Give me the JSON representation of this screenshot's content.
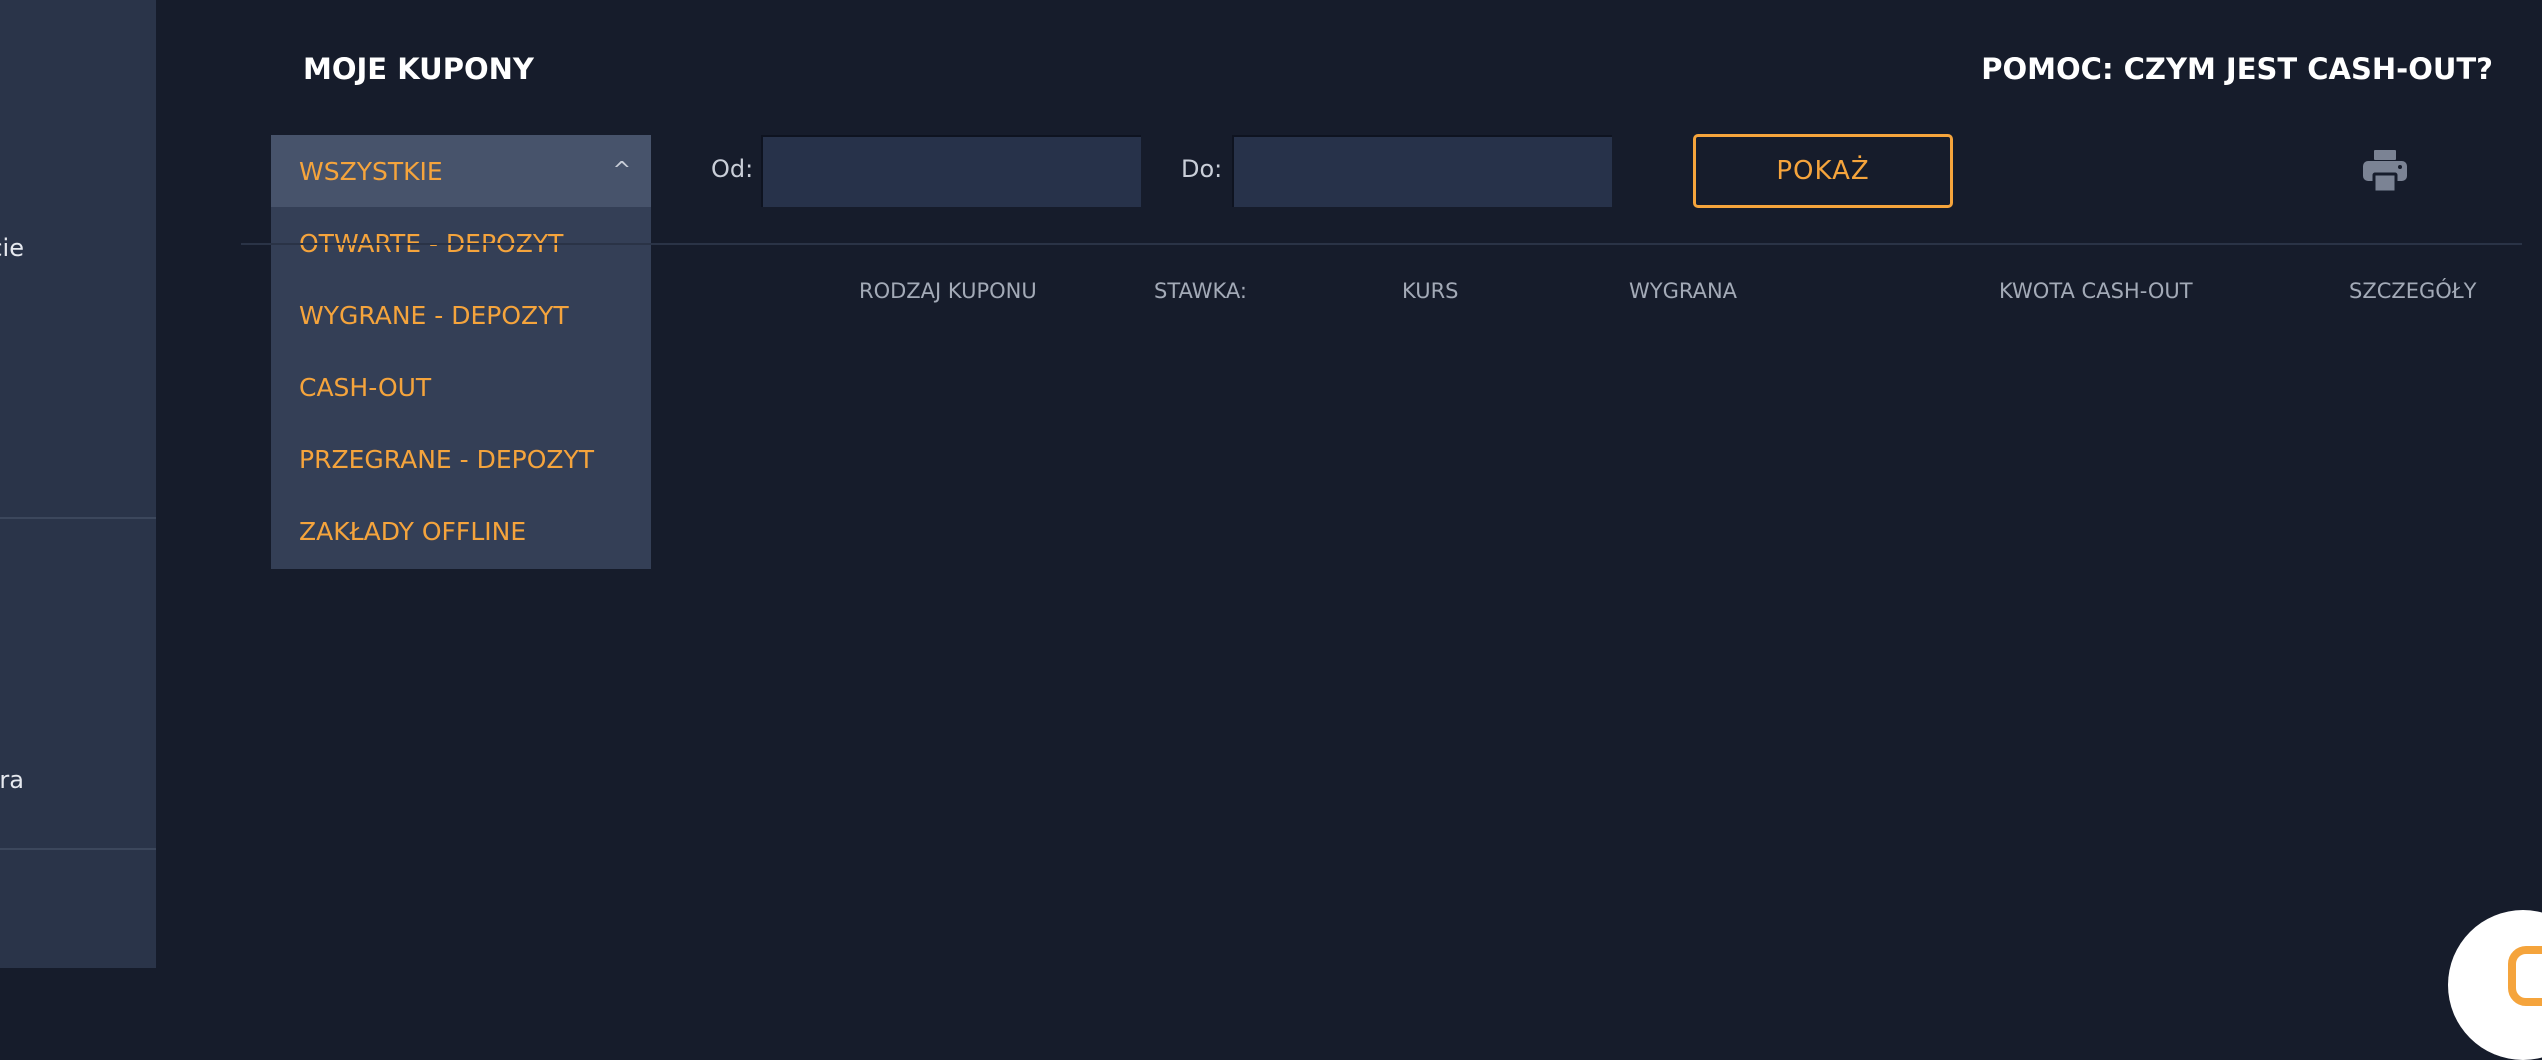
{
  "sidebar": {
    "fragments": [
      "cie",
      "gra"
    ]
  },
  "header": {
    "title": "MOJE KUPONY",
    "help_link": "POMOC: CZYM JEST CASH-OUT?"
  },
  "filter": {
    "selected": "WSZYSTKIE",
    "options": [
      "OTWARTE - DEPOZYT",
      "WYGRANE - DEPOZYT",
      "CASH-OUT",
      "PRZEGRANE - DEPOZYT",
      "ZAKŁADY OFFLINE"
    ],
    "from_label": "Od:",
    "from_value": "",
    "to_label": "Do:",
    "to_value": "",
    "show_button": "POKAŻ"
  },
  "table": {
    "columns": [
      "RODZAJ KUPONU",
      "STAWKA:",
      "KURS",
      "WYGRANA",
      "KWOTA CASH-OUT",
      "SZCZEGÓŁY"
    ]
  },
  "colors": {
    "accent": "#f5a43c",
    "background": "#161c2b",
    "sidebar": "#2a3449"
  },
  "icons": {
    "caret": "chevron-up-icon",
    "print": "printer-icon",
    "chat": "chat-icon"
  }
}
